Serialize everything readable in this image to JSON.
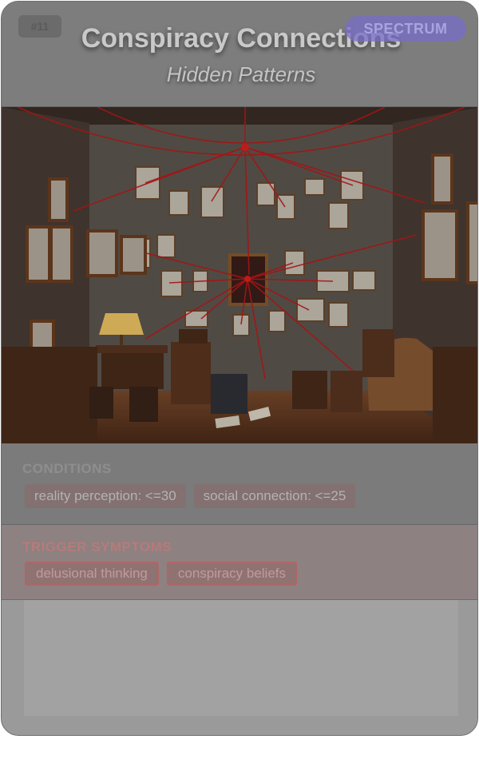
{
  "card": {
    "id_badge": "#11",
    "title": "Conspiracy Connections",
    "subtitle": "Hidden Patterns",
    "category_badge": "SPECTRUM"
  },
  "conditions": {
    "heading": "CONDITIONS",
    "tags": [
      "reality perception: <=30",
      "social connection: <=25"
    ]
  },
  "triggers": {
    "heading": "TRIGGER SYMPTOMS",
    "tags": [
      "delusional thinking",
      "conspiracy beliefs"
    ]
  },
  "colors": {
    "card_bg": "#8a8a8a",
    "badge_purple": "#786ec8",
    "trigger_red": "#b06565",
    "string_red": "#c21818"
  },
  "art_icon": "conspiracy-room-illustration"
}
